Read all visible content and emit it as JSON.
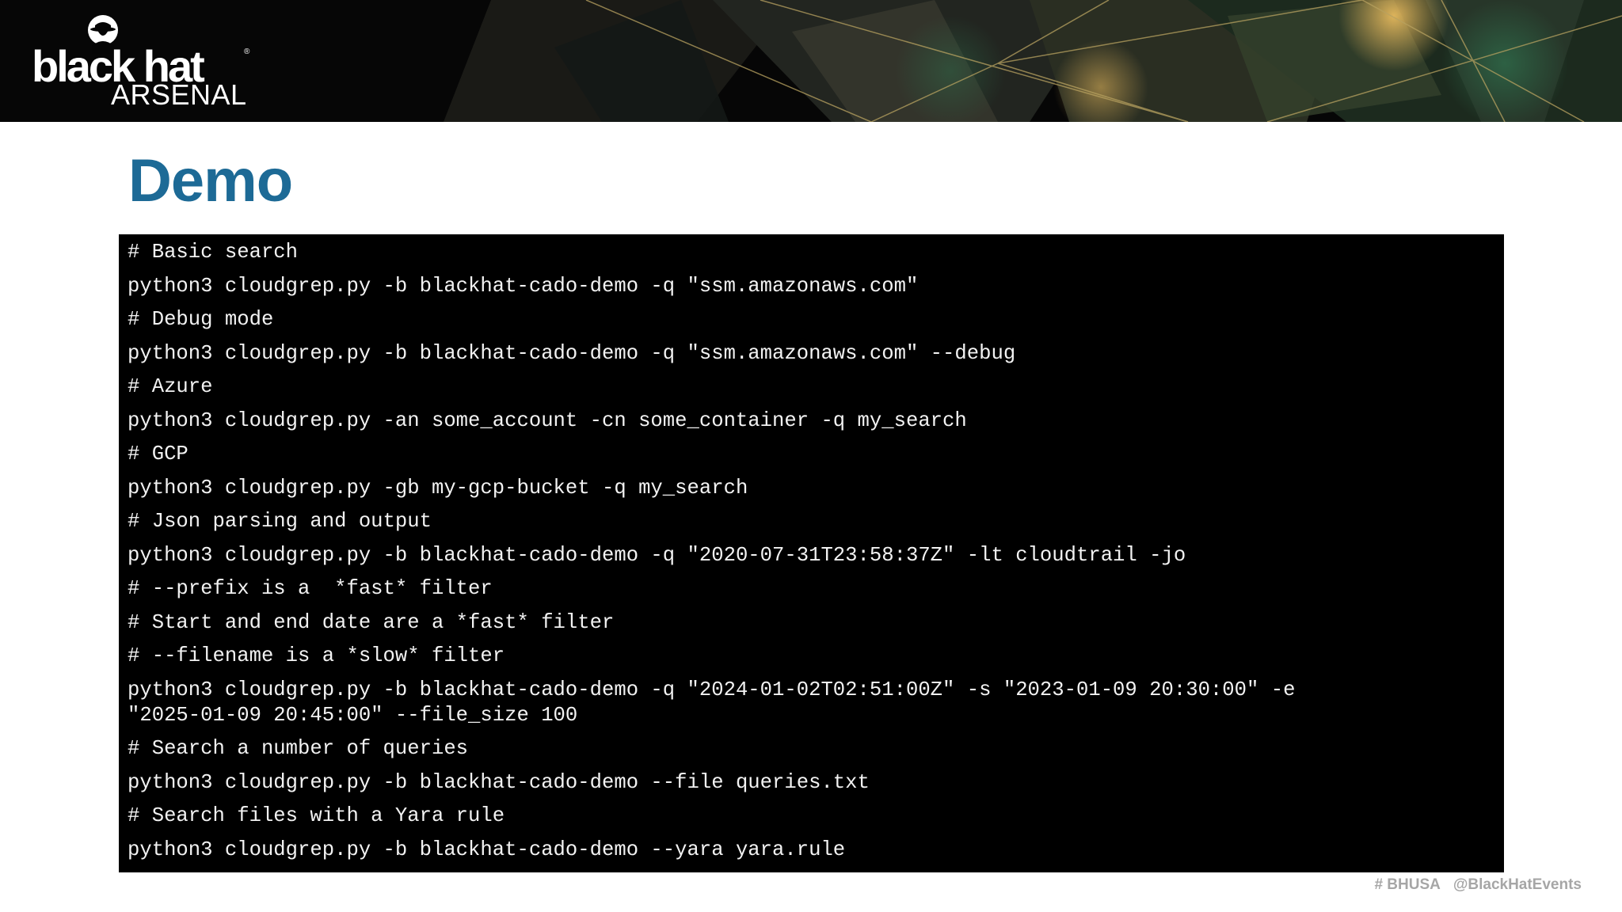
{
  "banner": {
    "logo_main": "black hat",
    "logo_sub": "ARSENAL",
    "logo_reg": "®"
  },
  "slide": {
    "title": "Demo"
  },
  "code": {
    "lines": [
      "# Basic search",
      "python3 cloudgrep.py -b blackhat-cado-demo -q \"ssm.amazonaws.com\"",
      "# Debug mode",
      "python3 cloudgrep.py -b blackhat-cado-demo -q \"ssm.amazonaws.com\" --debug",
      "# Azure",
      "python3 cloudgrep.py -an some_account -cn some_container -q my_search",
      "# GCP",
      "python3 cloudgrep.py -gb my-gcp-bucket -q my_search",
      "# Json parsing and output",
      "python3 cloudgrep.py -b blackhat-cado-demo -q \"2020-07-31T23:58:37Z\" -lt cloudtrail -jo",
      "# --prefix is a  *fast* filter",
      "# Start and end date are a *fast* filter",
      "# --filename is a *slow* filter",
      "python3 cloudgrep.py -b blackhat-cado-demo -q \"2024-01-02T02:51:00Z\" -s \"2023-01-09 20:30:00\" -e\n\"2025-01-09 20:45:00\" --file_size 100",
      "# Search a number of queries",
      "python3 cloudgrep.py -b blackhat-cado-demo --file queries.txt",
      "# Search files with a Yara rule",
      "python3 cloudgrep.py -b blackhat-cado-demo --yara yara.rule"
    ]
  },
  "footer": {
    "hashtag": "# BHUSA",
    "handle": "@BlackHatEvents"
  },
  "colors": {
    "title": "#1d6a96",
    "code_bg": "#000000",
    "code_text": "#f2f2f2",
    "footer": "#a6a6a6",
    "banner_bg": "#050505"
  }
}
